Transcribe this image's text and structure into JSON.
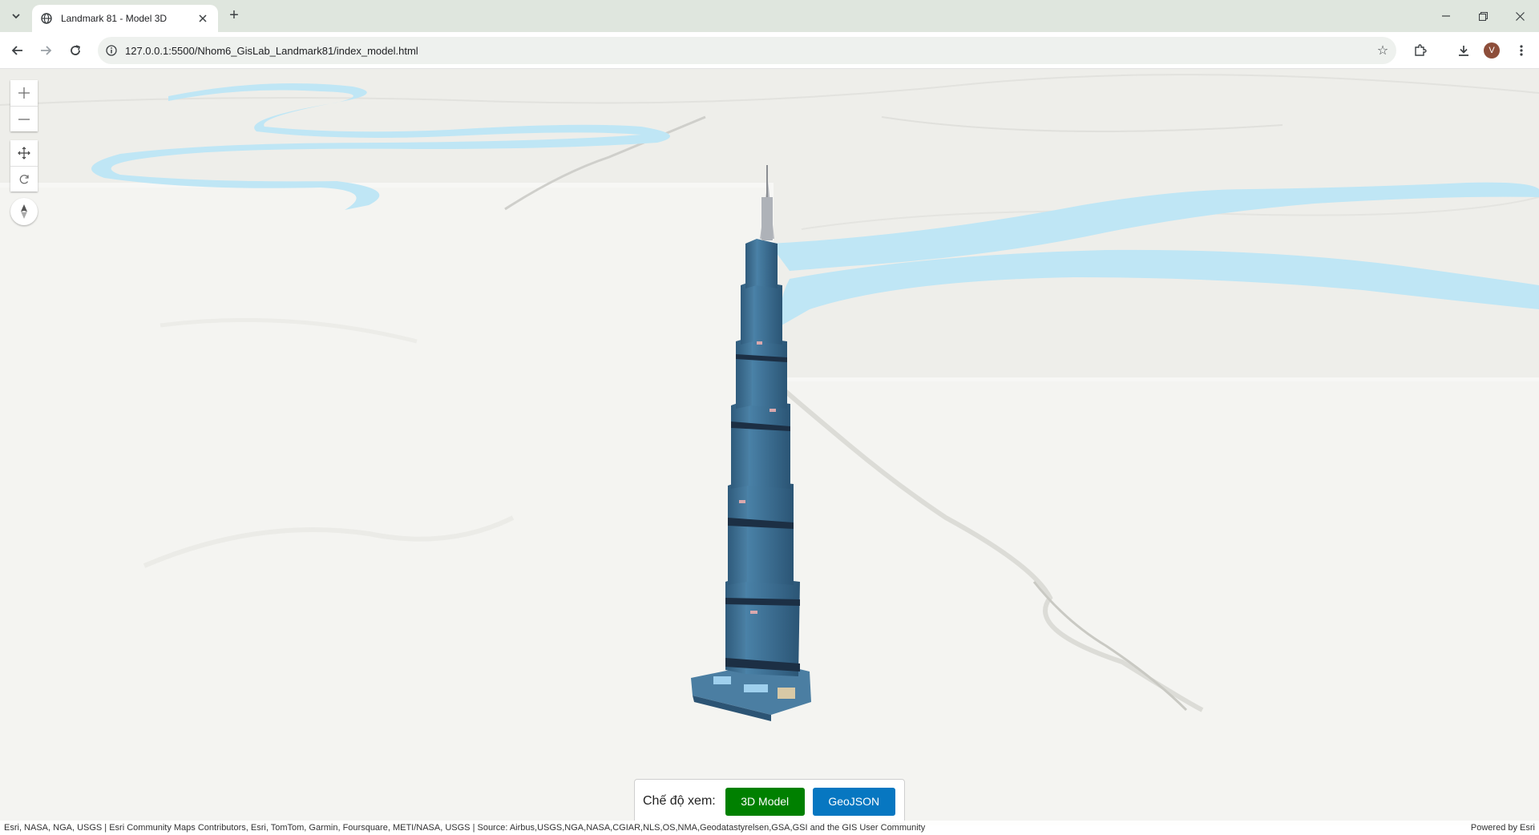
{
  "browser": {
    "tab": {
      "title": "Landmark 81 - Model 3D",
      "favicon": "globe-icon"
    },
    "address": {
      "url": "127.0.0.1:5500/Nhom6_GisLab_Landmark81/index_model.html"
    },
    "profile_initial": "V"
  },
  "map": {
    "nav_controls": [
      "zoom-in",
      "zoom-out",
      "pan",
      "rotate",
      "compass"
    ],
    "view_mode": {
      "label": "Chế độ xem:",
      "model_button": "3D Model",
      "geojson_button": "GeoJSON",
      "model_color": "#008000",
      "geojson_color": "#0777c1"
    },
    "attribution": "Esri, NASA, NGA, USGS | Esri Community Maps Contributors, Esri, TomTom, Garmin, Foursquare, METI/NASA, USGS | Source: Airbus,USGS,NGA,NASA,CGIAR,NLS,OS,NMA,Geodatastyrelsen,GSA,GSI and the GIS User Community",
    "powered_by": "Powered by Esri",
    "colors": {
      "water": "#bfe6f5",
      "ground": "#f4f4f1",
      "tower": "#3f6f92"
    }
  }
}
